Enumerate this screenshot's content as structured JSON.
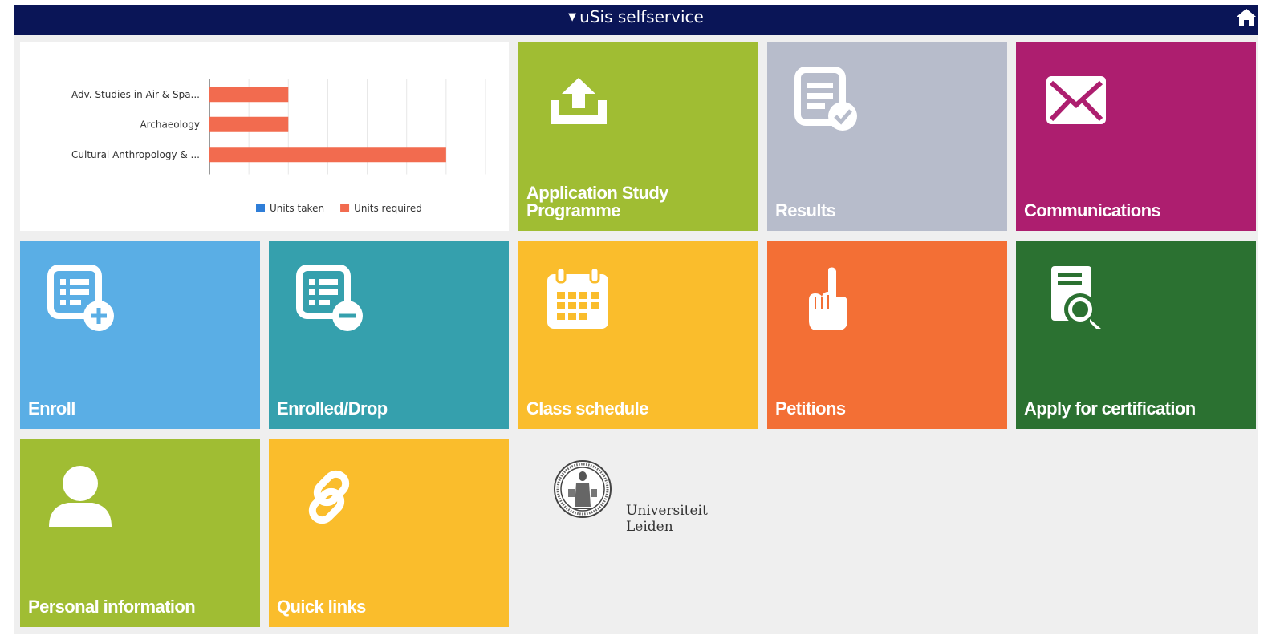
{
  "topbar": {
    "title": "uSis selfservice"
  },
  "chart_data": {
    "type": "bar",
    "orientation": "horizontal",
    "categories": [
      "Adv. Studies in Air & Spa...",
      "Archaeology",
      "Cultural Anthropology & ..."
    ],
    "series": [
      {
        "name": "Units taken",
        "color": "#2f7ed8",
        "values": [
          0,
          0,
          0
        ]
      },
      {
        "name": "Units required",
        "color": "#f26b4f",
        "values": [
          20,
          20,
          60
        ]
      }
    ],
    "xlim": [
      0,
      70
    ],
    "grid": true,
    "legend_position": "bottom-right"
  },
  "tiles": [
    {
      "label": "Application Study Programme",
      "color": "#a0bd33",
      "icon": "upload-icon"
    },
    {
      "label": "Results",
      "color": "#b7bccb",
      "icon": "results-icon"
    },
    {
      "label": "Communications",
      "color": "#ad1e6f",
      "icon": "envelope-icon"
    },
    {
      "label": "Enroll",
      "color": "#5aaee5",
      "icon": "enroll-icon"
    },
    {
      "label": "Enrolled/Drop",
      "color": "#35a0ad",
      "icon": "drop-icon"
    },
    {
      "label": "Class schedule",
      "color": "#fabd2c",
      "icon": "calendar-icon"
    },
    {
      "label": "Petitions",
      "color": "#f36f35",
      "icon": "hand-icon"
    },
    {
      "label": "Apply for certification",
      "color": "#2b7131",
      "icon": "certificate-icon"
    },
    {
      "label": "Personal information",
      "color": "#a0bd33",
      "icon": "person-icon"
    },
    {
      "label": "Quick links",
      "color": "#fabd2c",
      "icon": "link-icon"
    }
  ],
  "logo": {
    "line1": "Universiteit",
    "line2": "Leiden"
  }
}
